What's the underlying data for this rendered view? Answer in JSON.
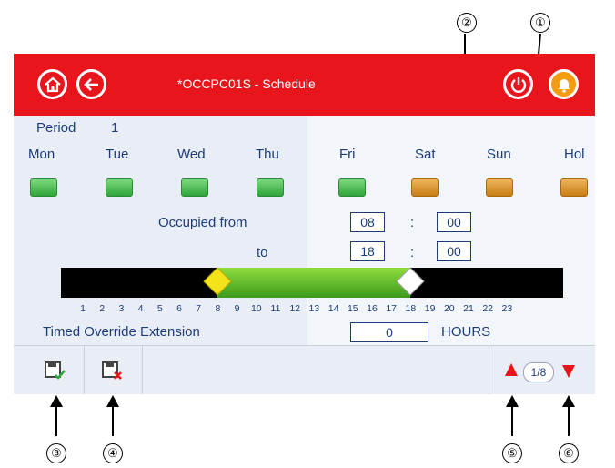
{
  "callouts": [
    "①",
    "②",
    "③",
    "④",
    "⑤",
    "⑥"
  ],
  "header": {
    "title": "*OCCPC01S - Schedule"
  },
  "period": {
    "label": "Period",
    "value": "1"
  },
  "days": [
    {
      "label": "Mon",
      "state": "on"
    },
    {
      "label": "Tue",
      "state": "on"
    },
    {
      "label": "Wed",
      "state": "on"
    },
    {
      "label": "Thu",
      "state": "on"
    },
    {
      "label": "Fri",
      "state": "on"
    },
    {
      "label": "Sat",
      "state": "off"
    },
    {
      "label": "Sun",
      "state": "off"
    },
    {
      "label": "Hol",
      "state": "off"
    }
  ],
  "occupied": {
    "from_label": "Occupied from",
    "to_label": "to",
    "from_hour": "08",
    "from_min": "00",
    "to_hour": "18",
    "to_min": "00",
    "separator": ":"
  },
  "timeline": {
    "hours": [
      "1",
      "2",
      "3",
      "4",
      "5",
      "6",
      "7",
      "8",
      "9",
      "10",
      "11",
      "12",
      "13",
      "14",
      "15",
      "16",
      "17",
      "18",
      "19",
      "20",
      "21",
      "22",
      "23"
    ],
    "start": 8,
    "end": 18
  },
  "override": {
    "label": "Timed Override Extension",
    "value": "0",
    "unit": "HOURS"
  },
  "pager": {
    "text": "1/8"
  },
  "colors": {
    "accent": "#e8161c",
    "text": "#1d3d78",
    "on": "#3fb04a",
    "off": "#e09a2e"
  }
}
